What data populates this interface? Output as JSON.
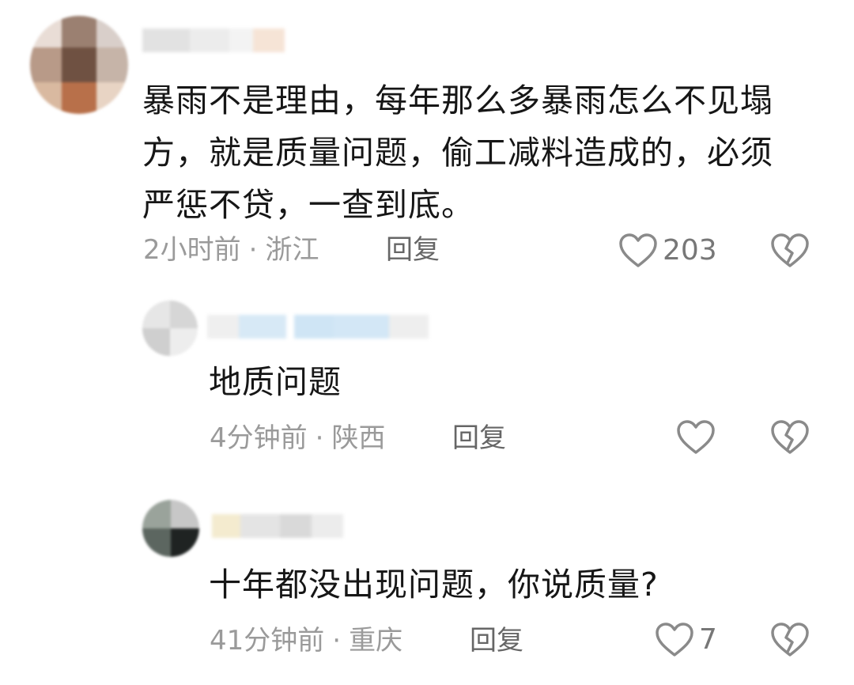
{
  "comments": [
    {
      "text": "暴雨不是理由，每年那么多暴雨怎么不见塌方，就是质量问题，偷工减料造成的，必须严惩不贷，一查到底。",
      "time": "2小时前",
      "location": "浙江",
      "reply_label": "回复",
      "likes": "203",
      "like_icon": "heart-outline-icon",
      "dislike_icon": "broken-heart-icon"
    },
    {
      "text": "地质问题",
      "time": "4分钟前",
      "location": "陕西",
      "reply_label": "回复",
      "likes": "",
      "like_icon": "heart-outline-icon",
      "dislike_icon": "broken-heart-icon"
    },
    {
      "text": "十年都没出现问题，你说质量?",
      "time": "41分钟前",
      "location": "重庆",
      "reply_label": "回复",
      "likes": "7",
      "like_icon": "heart-outline-icon",
      "dislike_icon": "broken-heart-icon"
    }
  ],
  "meta_separator": "·",
  "colors": {
    "text": "#161616",
    "meta": "#9a9a9a",
    "icon": "#8a8a8a"
  }
}
